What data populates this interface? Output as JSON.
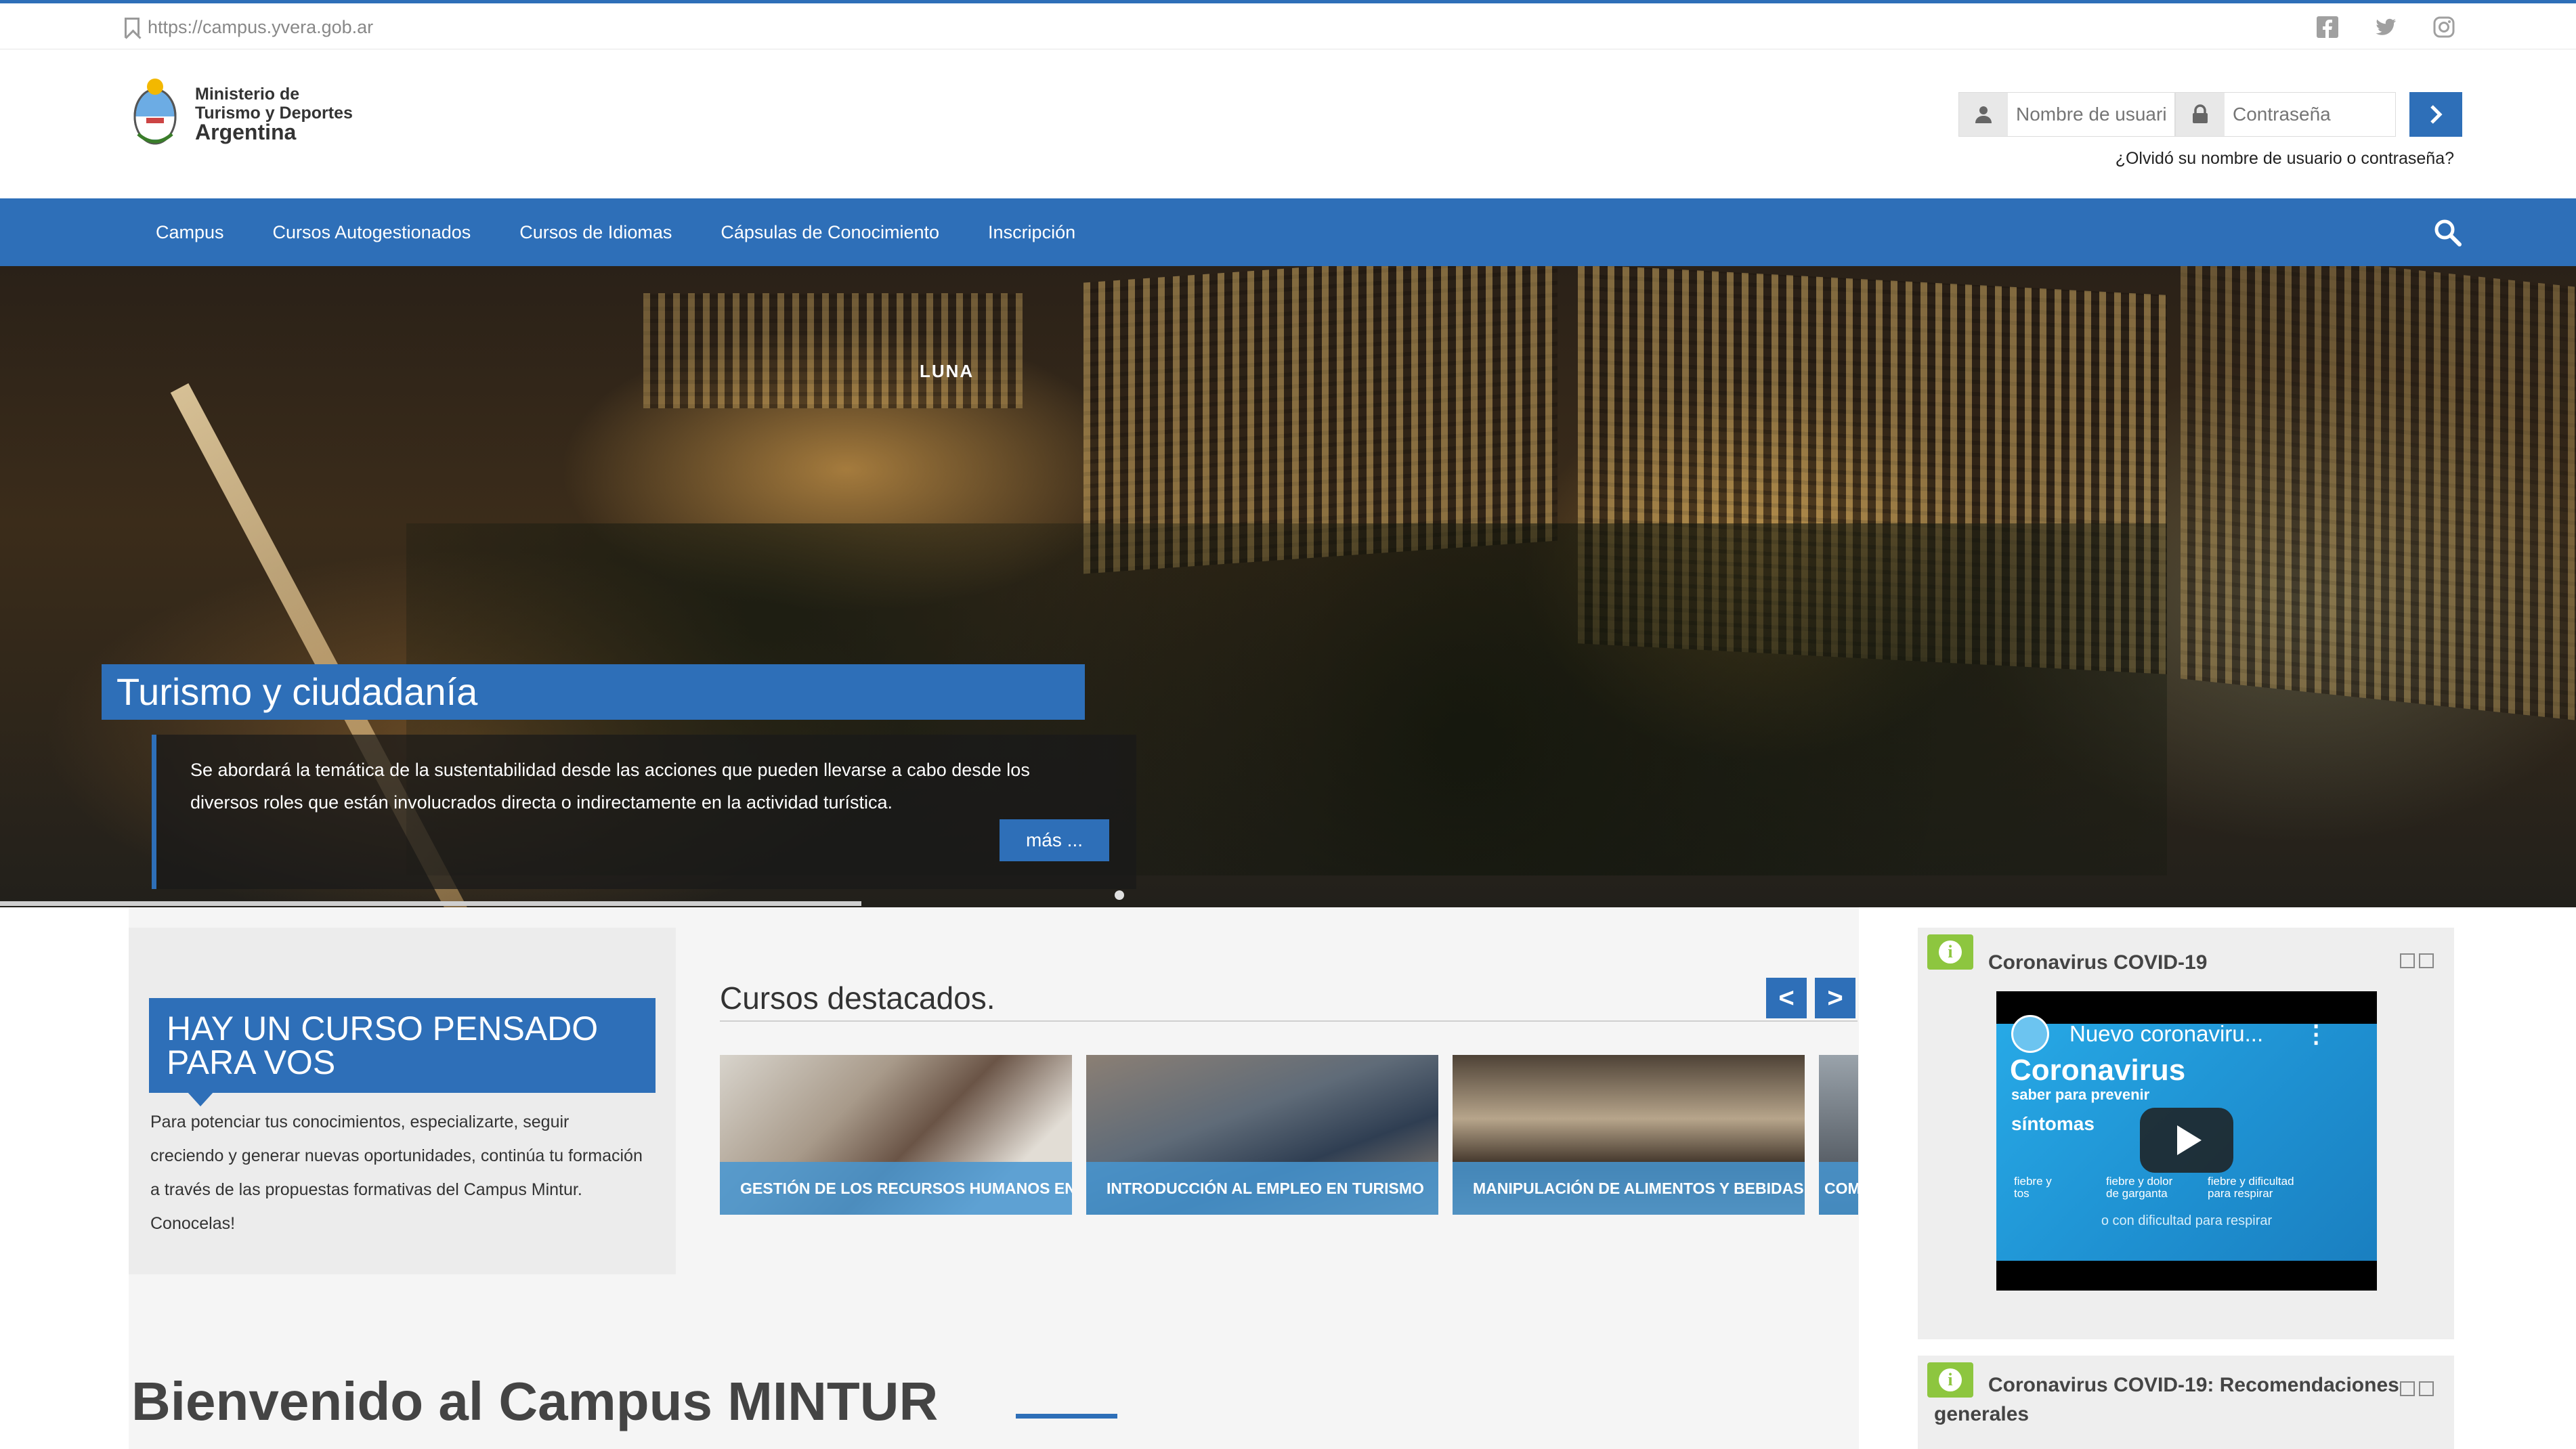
{
  "topbar": {
    "url": "https://campus.yvera.gob.ar",
    "social": [
      "facebook-icon",
      "twitter-icon",
      "instagram-icon"
    ]
  },
  "header": {
    "logo_line1": "Ministerio de",
    "logo_line2": "Turismo y Deportes",
    "logo_line3": "Argentina",
    "username_placeholder": "Nombre de usuario",
    "password_placeholder": "Contraseña",
    "forgot_link": "¿Olvidó su nombre de usuario o contraseña?"
  },
  "nav": {
    "items": [
      {
        "label": "Campus"
      },
      {
        "label": "Cursos Autogestionados"
      },
      {
        "label": "Cursos de Idiomas"
      },
      {
        "label": "Cápsulas de Conocimiento"
      },
      {
        "label": "Inscripción"
      }
    ]
  },
  "hero": {
    "title": "Turismo y ciudadanía",
    "description": "Se abordará la temática de la sustentabilidad desde las acciones que pueden llevarse a cabo desde los diversos roles que están involucrados directa o indirectamente en la actividad turística.",
    "more_label": "más ...",
    "image_text": "LUNA"
  },
  "promo": {
    "heading": "HAY UN CURSO PENSADO PARA VOS",
    "text": "Para potenciar tus conocimientos, especializarte, seguir creciendo y generar nuevas oportunidades, continúa tu formación a través de las propuestas formativas del Campus Mintur. Conocelas!"
  },
  "featured": {
    "title": "Cursos destacados.",
    "prev": "<",
    "next": ">",
    "courses": [
      {
        "label": "GESTIÓN DE LOS RECURSOS HUMANOS EN"
      },
      {
        "label": "INTRODUCCIÓN AL EMPLEO EN TURISMO"
      },
      {
        "label": "MANIPULACIÓN DE ALIMENTOS Y BEBIDAS"
      },
      {
        "label": "COM"
      }
    ]
  },
  "welcome": {
    "title": "Bienvenido al Campus MINTUR"
  },
  "sidebar": {
    "block1": {
      "title": "Coronavirus COVID-19",
      "video": {
        "title": "Nuevo coronaviru...",
        "big": "Coronavirus",
        "sub1": "saber para prevenir",
        "sub2": "síntomas",
        "symptom1": "fiebre y tos",
        "symptom2": "fiebre y dolor de garganta",
        "symptom3": "fiebre y dificultad para respirar",
        "bottom": "o con dificultad para respirar"
      }
    },
    "block2": {
      "title": "Coronavirus COVID-19: Recomendaciones",
      "title2": "generales"
    }
  },
  "colors": {
    "primary": "#2e6fb8",
    "block_icon": "#8dc63f"
  }
}
